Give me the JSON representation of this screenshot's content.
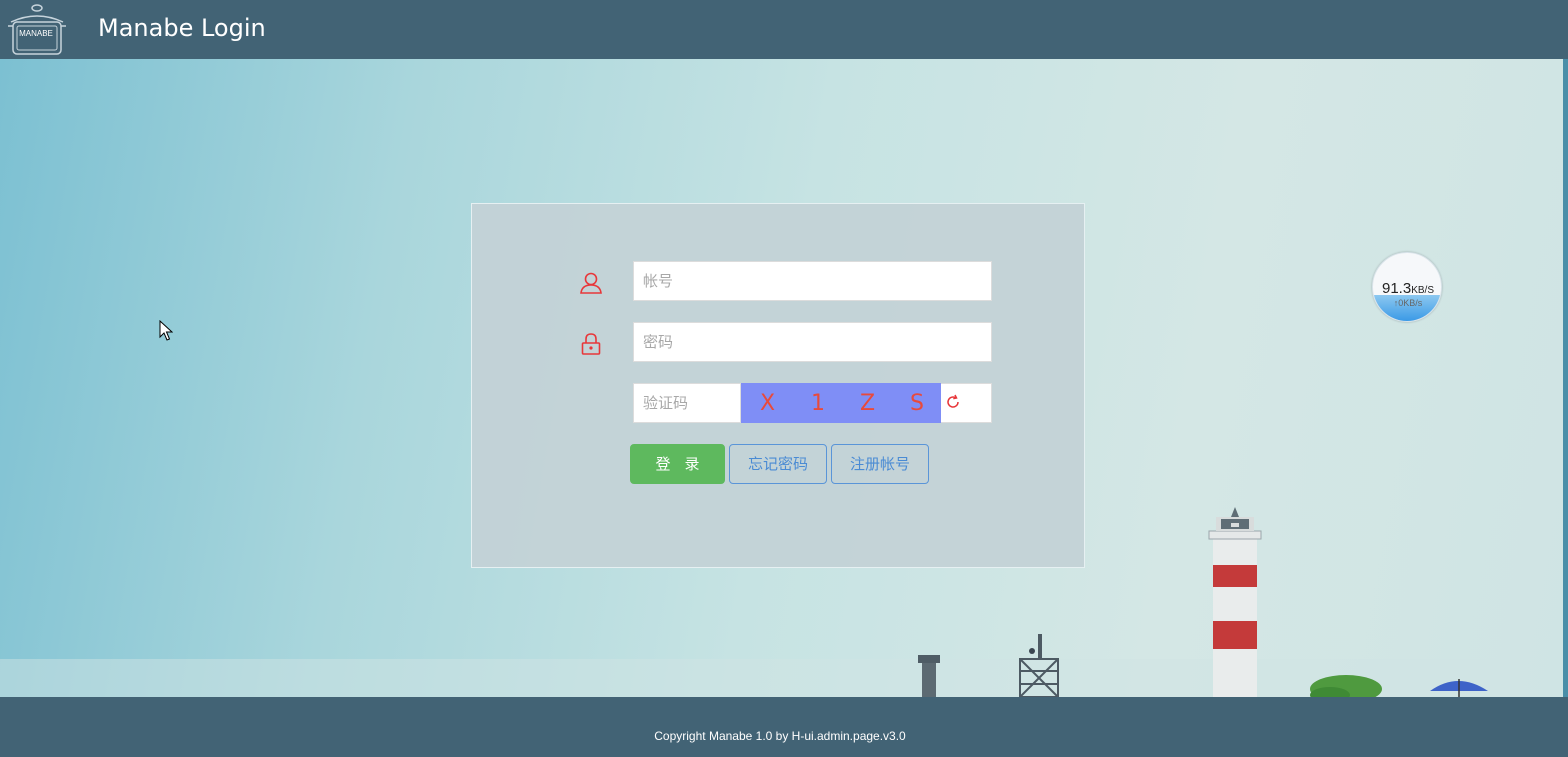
{
  "header": {
    "logo_text": "MANABE",
    "title": "Manabe Login"
  },
  "login": {
    "username_placeholder": "帐号",
    "password_placeholder": "密码",
    "captcha_placeholder": "验证码",
    "captcha_chars": [
      "X",
      "1",
      "Z",
      "S"
    ],
    "login_button": "登录",
    "forgot_button": "忘记密码",
    "register_button": "注册帐号"
  },
  "speed_widget": {
    "value": "91.3",
    "unit": "KB/S",
    "sub": "↑0KB/s"
  },
  "footer": {
    "copyright": "Copyright Manabe 1.0 by H-ui.admin.page.v3.0"
  },
  "colors": {
    "header_bg": "#426375",
    "login_green": "#5eb95e",
    "link_blue": "#4a8bd4",
    "captcha_bg": "#7f8ef6",
    "captcha_text": "#e84a3c",
    "icon_red": "#e8373a"
  }
}
